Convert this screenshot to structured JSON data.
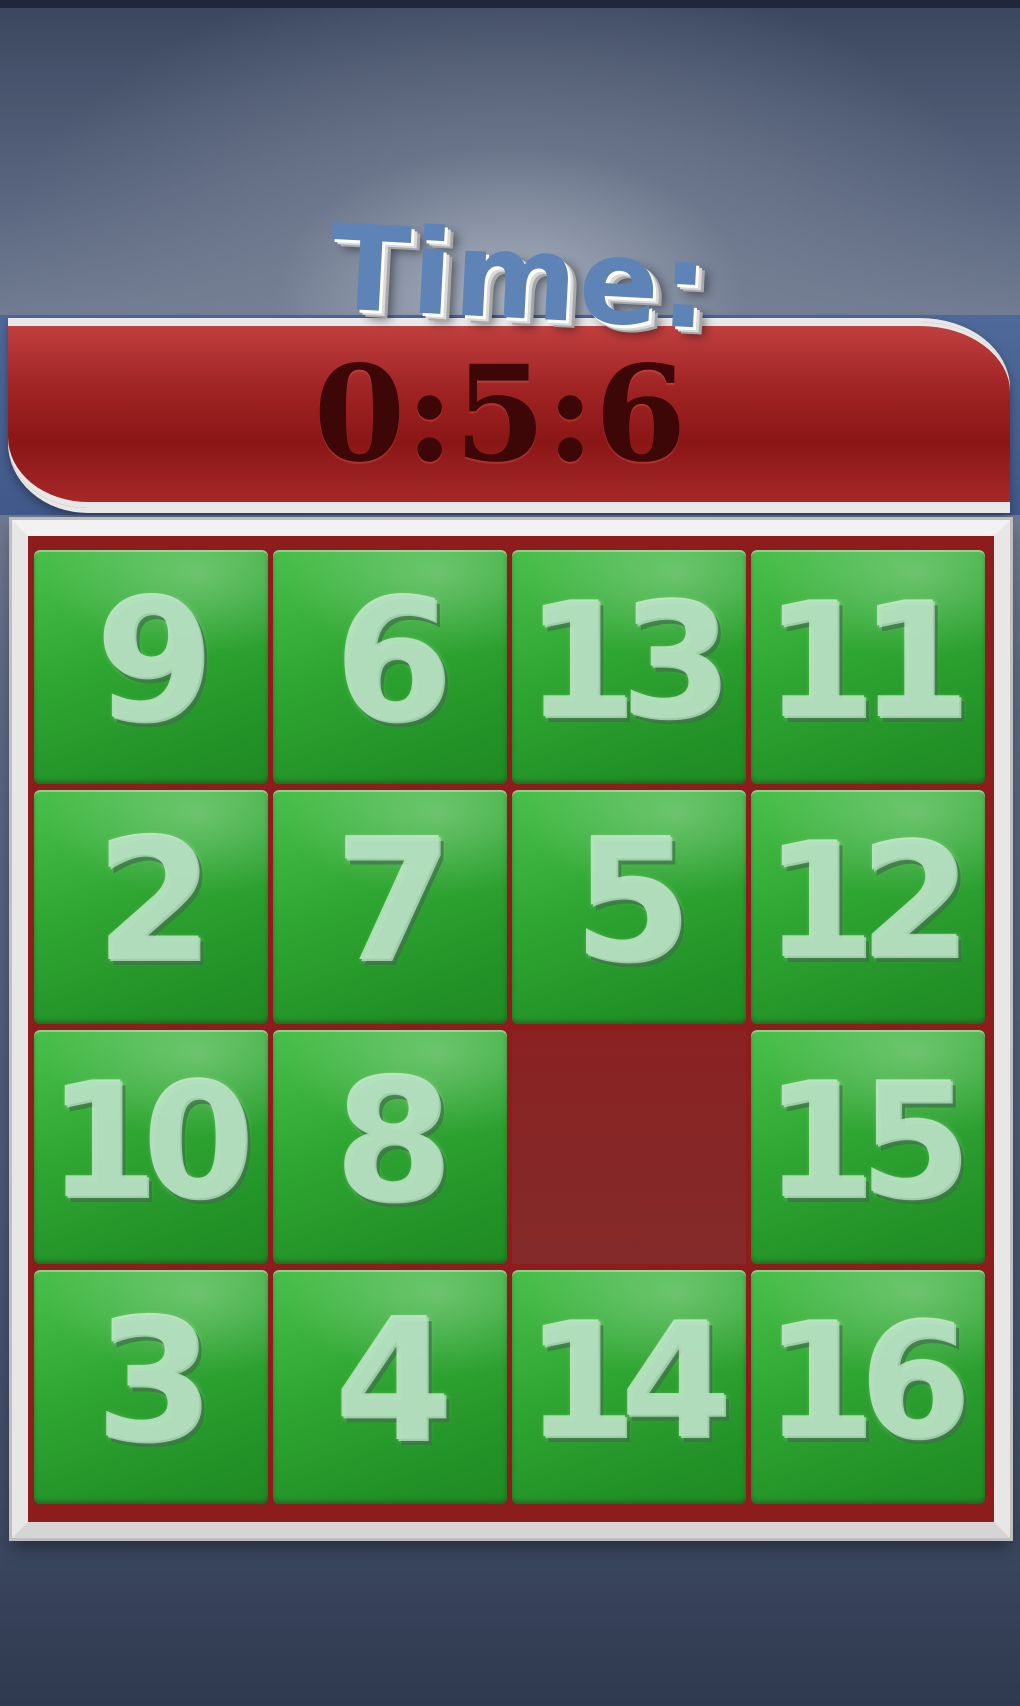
{
  "timer": {
    "label": "Time:",
    "value": "0:5:6"
  },
  "board": {
    "rows": 4,
    "cols": 4,
    "tiles": [
      [
        "9",
        "6",
        "13",
        "11"
      ],
      [
        "2",
        "7",
        "5",
        "12"
      ],
      [
        "10",
        "8",
        null,
        "15"
      ],
      [
        "3",
        "4",
        "14",
        "16"
      ]
    ]
  },
  "colors": {
    "tile_green": "#2fa532",
    "board_red": "#8f1c1c",
    "banner_red": "#a12424",
    "label_blue": "#5e84b7",
    "timer_text": "#3e0707"
  }
}
